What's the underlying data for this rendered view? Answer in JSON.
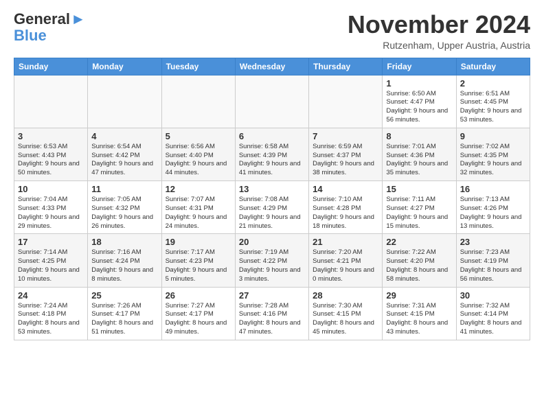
{
  "header": {
    "logo_line1": "General",
    "logo_line2": "Blue",
    "month": "November 2024",
    "location": "Rutzenham, Upper Austria, Austria"
  },
  "weekdays": [
    "Sunday",
    "Monday",
    "Tuesday",
    "Wednesday",
    "Thursday",
    "Friday",
    "Saturday"
  ],
  "weeks": [
    [
      {
        "day": "",
        "info": ""
      },
      {
        "day": "",
        "info": ""
      },
      {
        "day": "",
        "info": ""
      },
      {
        "day": "",
        "info": ""
      },
      {
        "day": "",
        "info": ""
      },
      {
        "day": "1",
        "info": "Sunrise: 6:50 AM\nSunset: 4:47 PM\nDaylight: 9 hours and 56 minutes."
      },
      {
        "day": "2",
        "info": "Sunrise: 6:51 AM\nSunset: 4:45 PM\nDaylight: 9 hours and 53 minutes."
      }
    ],
    [
      {
        "day": "3",
        "info": "Sunrise: 6:53 AM\nSunset: 4:43 PM\nDaylight: 9 hours and 50 minutes."
      },
      {
        "day": "4",
        "info": "Sunrise: 6:54 AM\nSunset: 4:42 PM\nDaylight: 9 hours and 47 minutes."
      },
      {
        "day": "5",
        "info": "Sunrise: 6:56 AM\nSunset: 4:40 PM\nDaylight: 9 hours and 44 minutes."
      },
      {
        "day": "6",
        "info": "Sunrise: 6:58 AM\nSunset: 4:39 PM\nDaylight: 9 hours and 41 minutes."
      },
      {
        "day": "7",
        "info": "Sunrise: 6:59 AM\nSunset: 4:37 PM\nDaylight: 9 hours and 38 minutes."
      },
      {
        "day": "8",
        "info": "Sunrise: 7:01 AM\nSunset: 4:36 PM\nDaylight: 9 hours and 35 minutes."
      },
      {
        "day": "9",
        "info": "Sunrise: 7:02 AM\nSunset: 4:35 PM\nDaylight: 9 hours and 32 minutes."
      }
    ],
    [
      {
        "day": "10",
        "info": "Sunrise: 7:04 AM\nSunset: 4:33 PM\nDaylight: 9 hours and 29 minutes."
      },
      {
        "day": "11",
        "info": "Sunrise: 7:05 AM\nSunset: 4:32 PM\nDaylight: 9 hours and 26 minutes."
      },
      {
        "day": "12",
        "info": "Sunrise: 7:07 AM\nSunset: 4:31 PM\nDaylight: 9 hours and 24 minutes."
      },
      {
        "day": "13",
        "info": "Sunrise: 7:08 AM\nSunset: 4:29 PM\nDaylight: 9 hours and 21 minutes."
      },
      {
        "day": "14",
        "info": "Sunrise: 7:10 AM\nSunset: 4:28 PM\nDaylight: 9 hours and 18 minutes."
      },
      {
        "day": "15",
        "info": "Sunrise: 7:11 AM\nSunset: 4:27 PM\nDaylight: 9 hours and 15 minutes."
      },
      {
        "day": "16",
        "info": "Sunrise: 7:13 AM\nSunset: 4:26 PM\nDaylight: 9 hours and 13 minutes."
      }
    ],
    [
      {
        "day": "17",
        "info": "Sunrise: 7:14 AM\nSunset: 4:25 PM\nDaylight: 9 hours and 10 minutes."
      },
      {
        "day": "18",
        "info": "Sunrise: 7:16 AM\nSunset: 4:24 PM\nDaylight: 9 hours and 8 minutes."
      },
      {
        "day": "19",
        "info": "Sunrise: 7:17 AM\nSunset: 4:23 PM\nDaylight: 9 hours and 5 minutes."
      },
      {
        "day": "20",
        "info": "Sunrise: 7:19 AM\nSunset: 4:22 PM\nDaylight: 9 hours and 3 minutes."
      },
      {
        "day": "21",
        "info": "Sunrise: 7:20 AM\nSunset: 4:21 PM\nDaylight: 9 hours and 0 minutes."
      },
      {
        "day": "22",
        "info": "Sunrise: 7:22 AM\nSunset: 4:20 PM\nDaylight: 8 hours and 58 minutes."
      },
      {
        "day": "23",
        "info": "Sunrise: 7:23 AM\nSunset: 4:19 PM\nDaylight: 8 hours and 56 minutes."
      }
    ],
    [
      {
        "day": "24",
        "info": "Sunrise: 7:24 AM\nSunset: 4:18 PM\nDaylight: 8 hours and 53 minutes."
      },
      {
        "day": "25",
        "info": "Sunrise: 7:26 AM\nSunset: 4:17 PM\nDaylight: 8 hours and 51 minutes."
      },
      {
        "day": "26",
        "info": "Sunrise: 7:27 AM\nSunset: 4:17 PM\nDaylight: 8 hours and 49 minutes."
      },
      {
        "day": "27",
        "info": "Sunrise: 7:28 AM\nSunset: 4:16 PM\nDaylight: 8 hours and 47 minutes."
      },
      {
        "day": "28",
        "info": "Sunrise: 7:30 AM\nSunset: 4:15 PM\nDaylight: 8 hours and 45 minutes."
      },
      {
        "day": "29",
        "info": "Sunrise: 7:31 AM\nSunset: 4:15 PM\nDaylight: 8 hours and 43 minutes."
      },
      {
        "day": "30",
        "info": "Sunrise: 7:32 AM\nSunset: 4:14 PM\nDaylight: 8 hours and 41 minutes."
      }
    ]
  ]
}
